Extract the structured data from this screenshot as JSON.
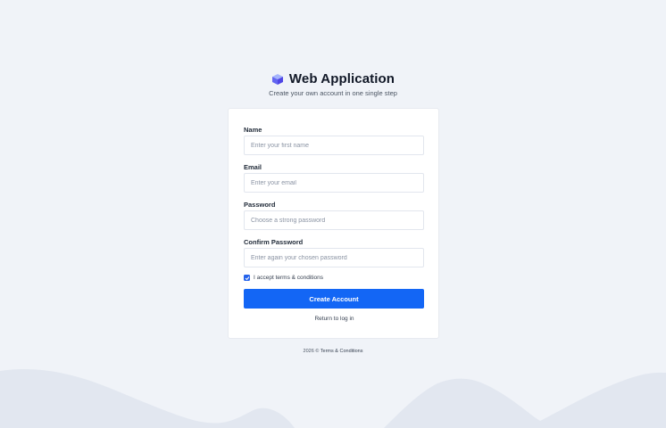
{
  "header": {
    "logo_icon": "cube-icon",
    "title": "Web Application",
    "subtitle": "Create your own account in one single step"
  },
  "form": {
    "name": {
      "label": "Name",
      "placeholder": "Enter your first name",
      "value": ""
    },
    "email": {
      "label": "Email",
      "placeholder": "Enter your email",
      "value": ""
    },
    "password": {
      "label": "Password",
      "placeholder": "Choose a strong password",
      "value": ""
    },
    "confirm_password": {
      "label": "Confirm Password",
      "placeholder": "Enter again your chosen password",
      "value": ""
    },
    "terms": {
      "label": "I accept terms & conditions",
      "checked": true
    },
    "submit_label": "Create Account",
    "return_link": "Return to log in"
  },
  "footer": {
    "year": "2026",
    "copyright_symbol": "©",
    "terms_link": "Terms & Conditions"
  },
  "colors": {
    "background": "#f0f3f8",
    "primary": "#1366f5",
    "logo": "#6366f1",
    "wave": "#e2e7f0"
  }
}
